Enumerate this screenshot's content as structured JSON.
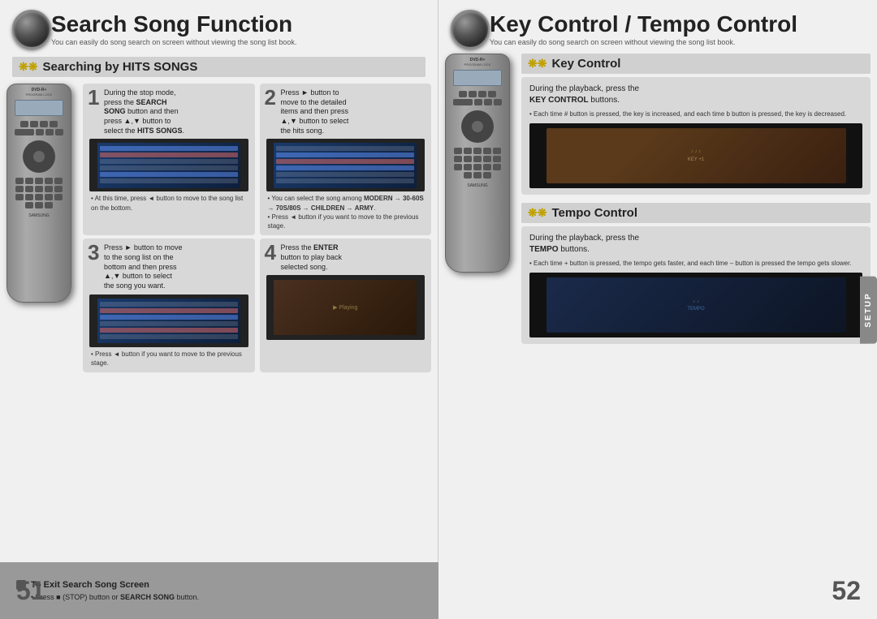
{
  "left": {
    "section_title": "Search Song Function",
    "section_subtitle": "You can easily do song search on screen without viewing the song list book.",
    "sub_section_title": "Searching by HITS SONGS",
    "steps": [
      {
        "number": "1",
        "main_text": "During the stop mode, press the SEARCH SONG button and then press ▲,▼ button to select the HITS SONGS.",
        "bold_parts": [
          "SEARCH SONG",
          "▲,▼"
        ],
        "note": "• At this time, press ◄ button to move to the song list on the bottom."
      },
      {
        "number": "2",
        "main_text": "Press ► button to move to the detailed items and then press ▲,▼ button to select the hits song.",
        "bold_parts": [
          "►",
          "▲,▼"
        ],
        "note": "• You can select the song among MODERN → 30-60S → 70S/80S → CHILDREN → ARMY.\n• Press ◄ button if you want to move to the previous stage."
      },
      {
        "number": "3",
        "main_text": "Press ► button to move to the song list on the bottom and then press ▲,▼ button to select the song you want.",
        "bold_parts": [
          "►",
          "▲,▼"
        ],
        "note": "• Press ◄ button if you want to move to the previous stage."
      },
      {
        "number": "4",
        "main_text": "Press the ENTER button to play back selected song.",
        "bold_parts": [
          "ENTER"
        ]
      }
    ],
    "footer": {
      "title": "To Exit Search Song Screen",
      "text": "• Press ■ (STOP) button or SEARCH SONG button.",
      "bold_parts": [
        "SEARCH SONG"
      ]
    },
    "page_number": "51"
  },
  "right": {
    "section_title": "Key Control / Tempo Control",
    "section_subtitle": "You can easily do song search on screen without viewing the song list book.",
    "key_control": {
      "sub_title": "Key Control",
      "info_box_main": "During the playback, press the KEY CONTROL buttons.",
      "info_box_bold": "KEY CONTROL",
      "note": "• Each time # button is pressed, the key is increased, and each time b button is pressed, the key is decreased."
    },
    "tempo_control": {
      "sub_title": "Tempo Control",
      "info_box_main": "During the playback, press the TEMPO buttons.",
      "info_box_bold": "TEMPO",
      "note": "• Each time + button is pressed, the tempo gets faster, and each time – button is pressed the tempo gets slower."
    },
    "setup_tab": "SETUP",
    "page_number": "52"
  }
}
